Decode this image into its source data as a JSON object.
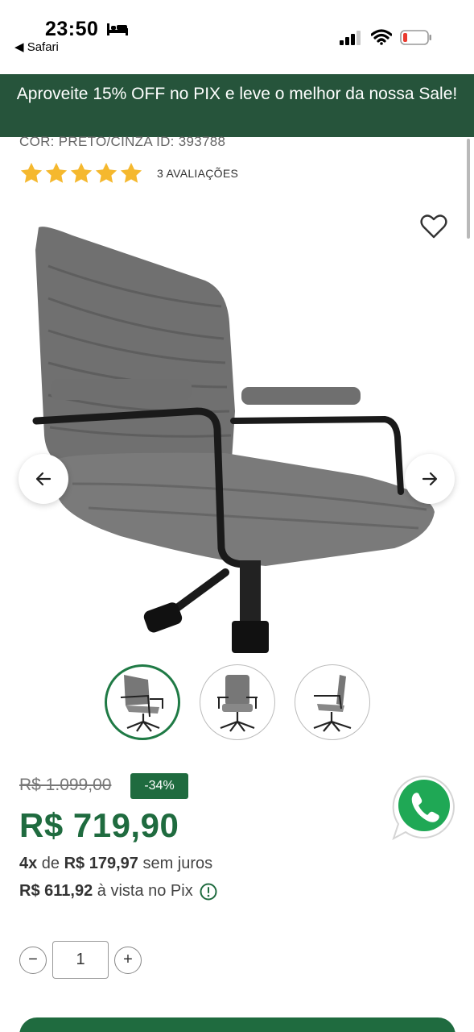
{
  "status_bar": {
    "time": "23:50",
    "back_label": "◀ Safari"
  },
  "promo": {
    "text": "Aproveite 15% OFF no PIX e leve o melhor da nossa Sale!"
  },
  "product": {
    "meta": "COR: PRETO/CINZA  ID: 393788",
    "rating_stars": 5,
    "rating_count": "3 AVALIAÇÕES",
    "thumbnails": [
      {
        "name": "thumb-front-angle",
        "active": true
      },
      {
        "name": "thumb-front",
        "active": false
      },
      {
        "name": "thumb-side",
        "active": false
      }
    ]
  },
  "pricing": {
    "old_price": "R$ 1.099,00",
    "discount": "-34%",
    "price": "R$ 719,90",
    "installments_count": "4x",
    "installments_de": " de ",
    "installments_value": "R$ 179,97",
    "installments_suffix": " sem juros",
    "pix_value": "R$ 611,92",
    "pix_suffix": " à vista no Pix"
  },
  "quantity": {
    "minus": "−",
    "value": "1",
    "plus": "+"
  },
  "colors": {
    "brand_green": "#1f6b3f",
    "banner_green": "#26543b",
    "star_yellow": "#f5b82e",
    "whatsapp_green": "#1fa855"
  },
  "icons": [
    "bed-icon",
    "signal-icon",
    "wifi-icon",
    "battery-icon",
    "heart-icon",
    "arrow-left-icon",
    "arrow-right-icon",
    "whatsapp-icon",
    "info-icon"
  ]
}
